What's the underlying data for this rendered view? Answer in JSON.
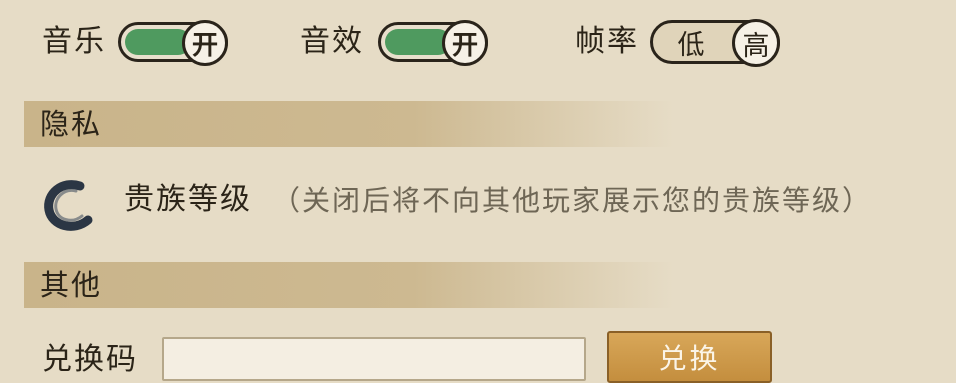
{
  "settings": {
    "music": {
      "label": "音乐",
      "state_text": "开",
      "on": true
    },
    "sfx": {
      "label": "音效",
      "state_text": "开",
      "on": true
    },
    "framerate": {
      "label": "帧率",
      "low": "低",
      "high": "高",
      "selected": "高"
    }
  },
  "privacy": {
    "header": "隐私",
    "noble_label": "贵族等级",
    "noble_note": "（关闭后将不向其他玩家展示您的贵族等级）"
  },
  "other": {
    "header": "其他",
    "code_label": "兑换码",
    "code_value": "",
    "redeem_button": "兑换"
  },
  "colors": {
    "toggle_on": "#4f9a5f",
    "accent_button": "#c48e3e",
    "section_bar": "#c9b48a"
  }
}
